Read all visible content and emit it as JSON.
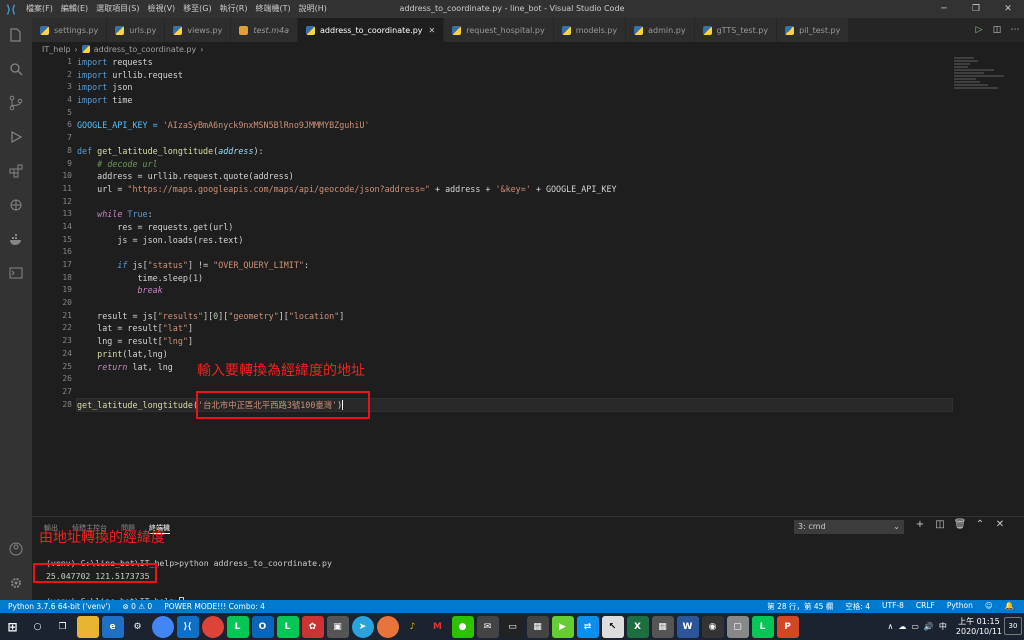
{
  "window": {
    "title": "address_to_coordinate.py - line_bot - Visual Studio Code",
    "menu": [
      "檔案(F)",
      "編輯(E)",
      "選取項目(S)",
      "檢視(V)",
      "移至(G)",
      "執行(R)",
      "終端機(T)",
      "說明(H)"
    ]
  },
  "tabs": [
    {
      "label": "settings.py"
    },
    {
      "label": "urls.py"
    },
    {
      "label": "views.py"
    },
    {
      "label": "test.m4a"
    },
    {
      "label": "address_to_coordinate.py",
      "active": true
    },
    {
      "label": "request_hospital.py"
    },
    {
      "label": "models.py"
    },
    {
      "label": "admin.py"
    },
    {
      "label": "gTTS_test.py"
    },
    {
      "label": "pil_test.py"
    }
  ],
  "breadcrumb": {
    "folder": "IT_help",
    "file": "address_to_coordinate.py"
  },
  "code": {
    "line_numbers": [
      "1",
      "2",
      "3",
      "4",
      "5",
      "6",
      "7",
      "8",
      "9",
      "10",
      "11",
      "12",
      "13",
      "14",
      "15",
      "16",
      "17",
      "18",
      "19",
      "20",
      "21",
      "22",
      "23",
      "24",
      "25",
      "26",
      "27",
      "28"
    ],
    "t": {
      "import": "import",
      "requests": " requests",
      "urllib": " urllib.request",
      "json": " json",
      "time": " time",
      "api_key_name": "GOOGLE_API_KEY = ",
      "api_key_val": "'AIzaSyBmA6nyck9nxMSN5BlRno9JMMMYBZguhiU'",
      "def": "def ",
      "fname": "get_latitude_longtitude",
      "paren_open": "(",
      "param": "address",
      "paren_close": "):",
      "comment": "    # decode url",
      "addr_assign": "    address = urllib.request.quote(address)",
      "url_assign": "    url = ",
      "url_str": "\"https://maps.googleapis.com/maps/api/geocode/json?address=\"",
      "url_plus": " + address + ",
      "key_str": "'&key='",
      "url_tail": " + GOOGLE_API_KEY",
      "indent4": "    ",
      "while": "while",
      "true_kw": " True",
      ":": ":",
      "res_line": "        res = requests.get(url)",
      "js_line": "        js = json.loads(res.text)",
      "indent8": "        ",
      "if": "if",
      "if_a": " js[",
      "status_str": "\"status\"",
      "if_b": "] != ",
      "oql_str": "\"OVER_QUERY_LIMIT\"",
      "if_c": ":",
      "sleep_a": "            time.sleep(",
      "sleep_num": "1",
      "sleep_b": ")",
      "indent12": "            ",
      "break": "break",
      "result_a": "    result = js[",
      "results_str": "\"results\"",
      "br0": "][",
      "zero": "0",
      "br1": "][",
      "geometry_str": "\"geometry\"",
      "br2": "][",
      "location_str": "\"location\"",
      "br3": "]",
      "lat_a": "    lat = result[",
      "lat_str": "\"lat\"",
      "lat_b": "]",
      "lng_a": "    lng = result[",
      "lng_str": "\"lng\"",
      "lng_b": "]",
      "print": "print",
      "print_args": "(lat,lng)",
      "return": "return",
      "return_args": " lat, lng",
      "call_fn": "get_latitude_longtitude",
      "call_open": "(",
      "call_str": "'台北市中正區北平西路3號100臺灣'",
      "call_close": ")"
    }
  },
  "annotations": {
    "input_label": "輸入要轉換為經緯度的地址",
    "output_label": "由地址轉換的經緯度"
  },
  "panel": {
    "tabs": [
      "輸出",
      "偵錯主控台",
      "問題",
      "終端機"
    ],
    "terminal_select": "3: cmd",
    "terminal_lines": [
      "(venv) C:\\line_bot\\IT_help>python address_to_coordinate.py",
      "25.047702 121.5173735",
      "",
      "(venv) C:\\line_bot\\IT_help>"
    ]
  },
  "status": {
    "python": "Python 3.7.6 64-bit ('venv')",
    "problems": "⊗ 0 ⚠ 0",
    "power_mode": "POWER MODE!!! Combo: 4",
    "position": "第 28 行，第 45 欄",
    "spaces": "空格: 4",
    "encoding": "UTF-8",
    "eol": "CRLF",
    "language": "Python"
  },
  "taskbar": {
    "time": "上午 01:15",
    "date": "2020/10/11",
    "notifications": "30",
    "ime": "中"
  },
  "colors": {
    "accent": "#007acc",
    "annotation": "#f0221f"
  }
}
